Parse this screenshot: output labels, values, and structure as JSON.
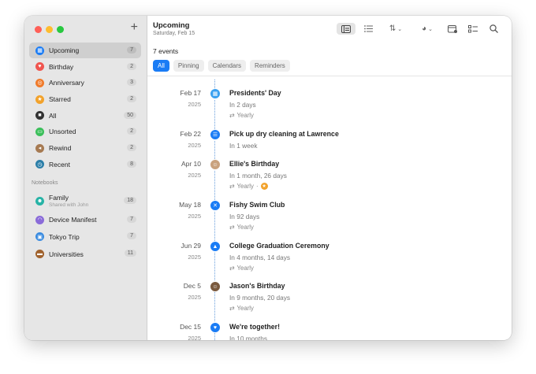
{
  "sidebar": {
    "items": [
      {
        "label": "Upcoming",
        "count": "7",
        "color": "#1a7cf5",
        "icon": "calendar-icon",
        "glyph": "▦"
      },
      {
        "label": "Birthday",
        "count": "2",
        "color": "#f0554f",
        "icon": "cake-icon",
        "glyph": "♥"
      },
      {
        "label": "Anniversary",
        "count": "3",
        "color": "#f07a2a",
        "icon": "ring-icon",
        "glyph": "◎"
      },
      {
        "label": "Starred",
        "count": "2",
        "color": "#f2a22b",
        "icon": "star-icon",
        "glyph": "★"
      },
      {
        "label": "All",
        "count": "50",
        "color": "#333333",
        "icon": "all-icon",
        "glyph": "■"
      },
      {
        "label": "Unsorted",
        "count": "2",
        "color": "#3bbf5a",
        "icon": "tray-icon",
        "glyph": "▭"
      },
      {
        "label": "Rewind",
        "count": "2",
        "color": "#a67a52",
        "icon": "rewind-icon",
        "glyph": "◂"
      },
      {
        "label": "Recent",
        "count": "8",
        "color": "#2b7ea8",
        "icon": "clock-icon",
        "glyph": "◷"
      }
    ],
    "notebooks_heading": "Notebooks",
    "notebooks": [
      {
        "label": "Family",
        "sub": "Shared with John",
        "count": "18",
        "color": "#27b3a6",
        "icon": "people-icon",
        "glyph": "☻"
      },
      {
        "label": "Device Manifest",
        "count": "7",
        "color": "#8a6bd9",
        "icon": "wifi-icon",
        "glyph": "◠"
      },
      {
        "label": "Tokyo Trip",
        "count": "7",
        "color": "#3a8be0",
        "icon": "photo-icon",
        "glyph": "▣"
      },
      {
        "label": "Universities",
        "count": "11",
        "color": "#a0622d",
        "icon": "folder-icon",
        "glyph": "▬"
      }
    ]
  },
  "header": {
    "title": "Upcoming",
    "subtitle": "Saturday, Feb 15"
  },
  "filter": {
    "count_label": "7 events",
    "chips": [
      "All",
      "Pinning",
      "Calendars",
      "Reminders"
    ]
  },
  "events": [
    {
      "date": "Feb 17",
      "year": "2025",
      "title": "Presidents' Day",
      "relative": "In 2 days",
      "repeat": "Yearly",
      "icon": "calendar-icon",
      "glyph": "▦",
      "color": "#3aa0f0"
    },
    {
      "date": "Feb 22",
      "year": "2025",
      "title": "Pick up dry cleaning at Lawrence",
      "relative": "In 1 week",
      "repeat": "",
      "icon": "checklist-icon",
      "glyph": "☰",
      "color": "#1a7cf5"
    },
    {
      "date": "Apr 10",
      "year": "2025",
      "title": "Ellie's Birthday",
      "relative": "In 1 month, 26 days",
      "repeat": "Yearly",
      "starred": true,
      "icon": "avatar-icon",
      "glyph": "☺",
      "color": "#c9a27e"
    },
    {
      "date": "May 18",
      "year": "2025",
      "title": "Fishy Swim Club",
      "relative": "In 92 days",
      "repeat": "Yearly",
      "icon": "swim-icon",
      "glyph": "✕",
      "color": "#1a7cf5"
    },
    {
      "date": "Jun 29",
      "year": "2025",
      "title": "College Graduation Ceremony",
      "relative": "In 4 months, 14 days",
      "repeat": "Yearly",
      "icon": "graduation-cap-icon",
      "glyph": "▲",
      "color": "#1a7cf5"
    },
    {
      "date": "Dec 5",
      "year": "2025",
      "title": "Jason's Birthday",
      "relative": "In 9 months, 20 days",
      "repeat": "Yearly",
      "icon": "avatar-icon",
      "glyph": "☺",
      "color": "#7a5a3e"
    },
    {
      "date": "Dec 15",
      "year": "2025",
      "title": "We're together!",
      "relative": "In 10 months",
      "repeat": "",
      "icon": "heart-icon",
      "glyph": "♥",
      "color": "#1a7cf5"
    }
  ]
}
